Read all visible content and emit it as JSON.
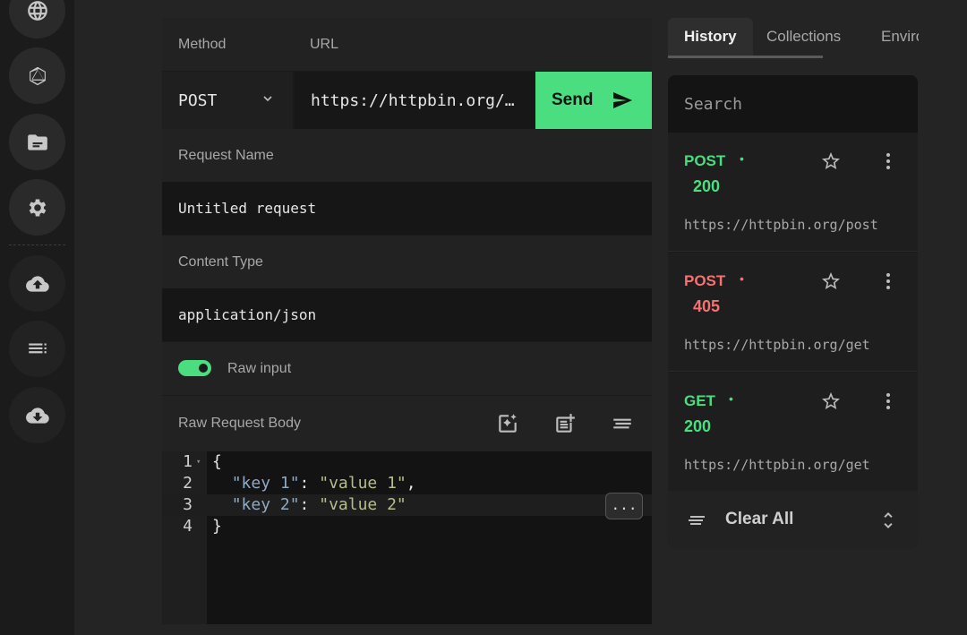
{
  "rail": {
    "icons": [
      "globe-icon",
      "graphql-icon",
      "folder-icon",
      "gear-icon",
      "cloud-upload-icon",
      "list-icon",
      "cloud-download-icon"
    ]
  },
  "request": {
    "method_label": "Method",
    "url_label": "URL",
    "method_value": "POST",
    "url_value": "https://httpbin.org/…",
    "send_label": "Send",
    "name_label": "Request Name",
    "name_value": "Untitled request",
    "content_type_label": "Content Type",
    "content_type_value": "application/json",
    "raw_input_label": "Raw input",
    "raw_input_on": true,
    "raw_body_label": "Raw Request Body"
  },
  "editor": {
    "line_numbers": [
      "1",
      "2",
      "3",
      "4"
    ],
    "lines": {
      "l1": "{",
      "l2_key": "\"key 1\"",
      "l2_sep": ": ",
      "l2_val": "\"value 1\"",
      "l2_end": ",",
      "l3_key": "\"key 2\"",
      "l3_sep": ": ",
      "l3_val": "\"value 2\"",
      "l4": "}"
    },
    "more_label": "..."
  },
  "side": {
    "tabs": [
      "History",
      "Collections",
      "Enviro"
    ],
    "search_placeholder": "Search",
    "history": [
      {
        "method": "POST",
        "status": "200",
        "url": "https://httpbin.org/post",
        "state": "ok"
      },
      {
        "method": "POST",
        "status": "405",
        "url": "https://httpbin.org/get",
        "state": "err"
      },
      {
        "method": "GET",
        "status": "200",
        "url": "https://httpbin.org/get",
        "state": "ok"
      }
    ],
    "dot": "•",
    "clear_label": "Clear All"
  },
  "colors": {
    "accent": "#4ade80",
    "error": "#f87171"
  }
}
